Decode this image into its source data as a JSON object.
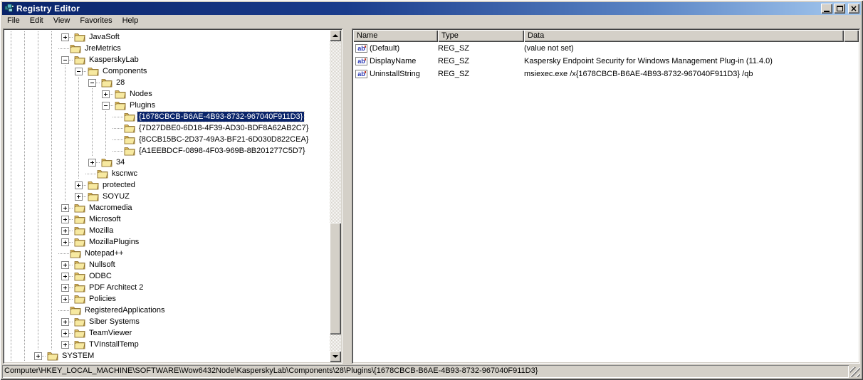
{
  "window": {
    "title": "Registry Editor",
    "buttons": [
      {
        "name": "minimize-button"
      },
      {
        "name": "maximize-button"
      },
      {
        "name": "close-button"
      }
    ]
  },
  "menu": {
    "items": [
      "File",
      "Edit",
      "View",
      "Favorites",
      "Help"
    ]
  },
  "tree": {
    "items": [
      {
        "label": "JavaSoft",
        "depth": 4,
        "expander": "plus"
      },
      {
        "label": "JreMetrics",
        "depth": 4,
        "expander": "none"
      },
      {
        "label": "KasperskyLab",
        "depth": 4,
        "expander": "minus"
      },
      {
        "label": "Components",
        "depth": 5,
        "expander": "minus"
      },
      {
        "label": "28",
        "depth": 6,
        "expander": "minus"
      },
      {
        "label": "Nodes",
        "depth": 7,
        "expander": "plus"
      },
      {
        "label": "Plugins",
        "depth": 7,
        "expander": "minus"
      },
      {
        "label": "{1678CBCB-B6AE-4B93-8732-967040F911D3}",
        "depth": 8,
        "expander": "none",
        "selected": true
      },
      {
        "label": "{7D27DBE0-6D18-4F39-AD30-BDF8A62AB2C7}",
        "depth": 8,
        "expander": "none"
      },
      {
        "label": "{8CCB15BC-2D37-49A3-BF21-6D030D822CEA}",
        "depth": 8,
        "expander": "none"
      },
      {
        "label": "{A1EEBDCF-0898-4F03-969B-8B201277C5D7}",
        "depth": 8,
        "expander": "none"
      },
      {
        "label": "34",
        "depth": 6,
        "expander": "plus"
      },
      {
        "label": "kscnwc",
        "depth": 6,
        "expander": "none"
      },
      {
        "label": "protected",
        "depth": 5,
        "expander": "plus"
      },
      {
        "label": "SOYUZ",
        "depth": 5,
        "expander": "plus"
      },
      {
        "label": "Macromedia",
        "depth": 4,
        "expander": "plus"
      },
      {
        "label": "Microsoft",
        "depth": 4,
        "expander": "plus"
      },
      {
        "label": "Mozilla",
        "depth": 4,
        "expander": "plus"
      },
      {
        "label": "MozillaPlugins",
        "depth": 4,
        "expander": "plus"
      },
      {
        "label": "Notepad++",
        "depth": 4,
        "expander": "none"
      },
      {
        "label": "Nullsoft",
        "depth": 4,
        "expander": "plus"
      },
      {
        "label": "ODBC",
        "depth": 4,
        "expander": "plus"
      },
      {
        "label": "PDF Architect 2",
        "depth": 4,
        "expander": "plus"
      },
      {
        "label": "Policies",
        "depth": 4,
        "expander": "plus"
      },
      {
        "label": "RegisteredApplications",
        "depth": 4,
        "expander": "none"
      },
      {
        "label": "Siber Systems",
        "depth": 4,
        "expander": "plus"
      },
      {
        "label": "TeamViewer",
        "depth": 4,
        "expander": "plus"
      },
      {
        "label": "TVInstallTemp",
        "depth": 4,
        "expander": "plus"
      },
      {
        "label": "SYSTEM",
        "depth": 2,
        "expander": "plus"
      }
    ]
  },
  "list": {
    "columns": [
      "Name",
      "Type",
      "Data"
    ],
    "rows": [
      {
        "icon": "string-value-icon",
        "name": "(Default)",
        "type": "REG_SZ",
        "data": "(value not set)"
      },
      {
        "icon": "string-value-icon",
        "name": "DisplayName",
        "type": "REG_SZ",
        "data": "Kaspersky Endpoint Security for Windows Management Plug-in (11.4.0)"
      },
      {
        "icon": "string-value-icon",
        "name": "UninstallString",
        "type": "REG_SZ",
        "data": "msiexec.exe /x{1678CBCB-B6AE-4B93-8732-967040F911D3} /qb"
      }
    ]
  },
  "status_bar": {
    "path": "Computer\\HKEY_LOCAL_MACHINE\\SOFTWARE\\Wow6432Node\\KasperskyLab\\Components\\28\\Plugins\\{1678CBCB-B6AE-4B93-8732-967040F911D3}"
  },
  "colors": {
    "titlebar_gradient_start": "#0a246a",
    "titlebar_gradient_end": "#a6caf0",
    "chrome": "#d4d0c8",
    "selection_bg": "#0a246a",
    "selection_text": "#ffffff",
    "pane_bg": "#ffffff",
    "folder_light": "#f7e9a0",
    "folder_dark": "#e0bc5e",
    "value_icon_text": "#2333b4"
  }
}
